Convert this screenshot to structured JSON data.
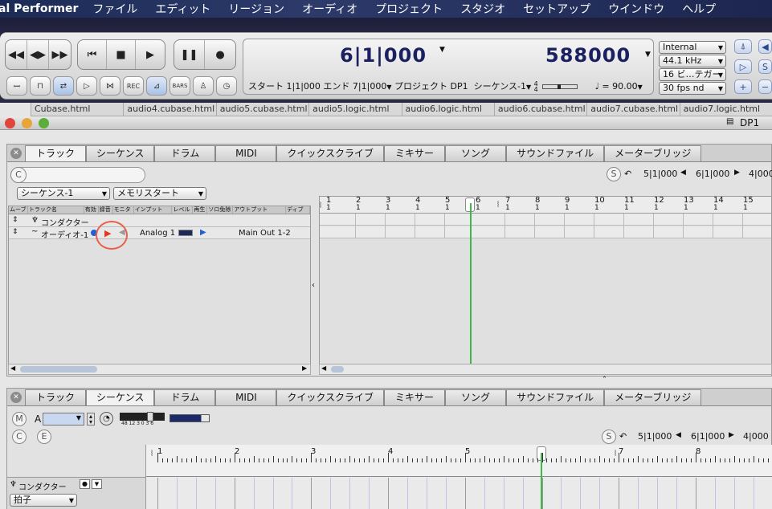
{
  "menubar": {
    "app": "al Performer",
    "items": [
      "ファイル",
      "エディット",
      "リージョン",
      "オーディオ",
      "プロジェクト",
      "スタジオ",
      "セットアップ",
      "ウインドウ",
      "ヘルプ"
    ]
  },
  "transport": {
    "main_counter": "6|1|000",
    "sample_counter": "588000",
    "sync_source": "Internal",
    "sample_rate": "44.1 kHz",
    "bit_depth": "16 ビ…テガー",
    "frame_rate": "30 fps nd",
    "start_label": "スタート",
    "start_value": "1|1|000",
    "end_label": "エンド",
    "end_value": "7|1|000",
    "project_label": "プロジェクト",
    "project_value": "DP1",
    "sequence_value": "シーケンス-1",
    "meter_top": "4",
    "meter_bottom": "4",
    "tempo_symbol": "♩ =",
    "tempo": "90.00",
    "bars_label": "BARS",
    "rec_label": "REC"
  },
  "file_tabs": [
    "Cubase.html",
    "audio4.cubase.html",
    "audio5.cubase.html",
    "audio5.logic.html",
    "audio6.logic.html",
    "audio6.cubase.html",
    "audio7.cubase.html",
    "audio7.logic.html"
  ],
  "window": {
    "title": "DP1"
  },
  "top_pane": {
    "tabs": [
      "トラック",
      "シーケンス",
      "ドラム",
      "MIDI",
      "クイックスクライブ",
      "ミキサー",
      "ソング",
      "サウンドファイル",
      "メーターブリッジ"
    ],
    "active_tab": "トラック",
    "c_button": "C",
    "s_button": "S",
    "loc1": "5|1|000",
    "loc2": "6|1|000",
    "loc3": "4|000",
    "sequence_select": "シーケンス-1",
    "memory_select": "メモリスタート",
    "columns": [
      "ムーブ",
      "トラック名",
      "有効",
      "録音",
      "モニタ",
      "インプット",
      "レベル",
      "再生",
      "ソロ免除",
      "アウトプット",
      "ディブ"
    ],
    "tracks": [
      {
        "name": "コンダクター"
      },
      {
        "name": "オーディオ-1",
        "input": "Analog 1",
        "output": "Main Out 1-2"
      }
    ],
    "ruler": [
      "1",
      "2",
      "3",
      "4",
      "5",
      "6",
      "7",
      "8",
      "9",
      "10",
      "11",
      "12",
      "13",
      "14",
      "15"
    ],
    "ruler_sub": "1"
  },
  "bottom_pane": {
    "tabs": [
      "トラック",
      "シーケンス",
      "ドラム",
      "MIDI",
      "クイックスクライブ",
      "ミキサー",
      "ソング",
      "サウンドファイル",
      "メーターブリッジ"
    ],
    "active_tab": "シーケンス",
    "m_button": "M",
    "a_label": "A",
    "c_button": "C",
    "e_button": "E",
    "s_button": "S",
    "loc1": "5|1|000",
    "loc2": "6|1|000",
    "loc3": "4|000",
    "meter_scale": "48  12  3 0 3 6",
    "conductor_label": "コンダクター",
    "beat_select": "拍子",
    "ruler": [
      "1",
      "2",
      "3",
      "4",
      "5",
      "6",
      "7",
      "8"
    ]
  }
}
